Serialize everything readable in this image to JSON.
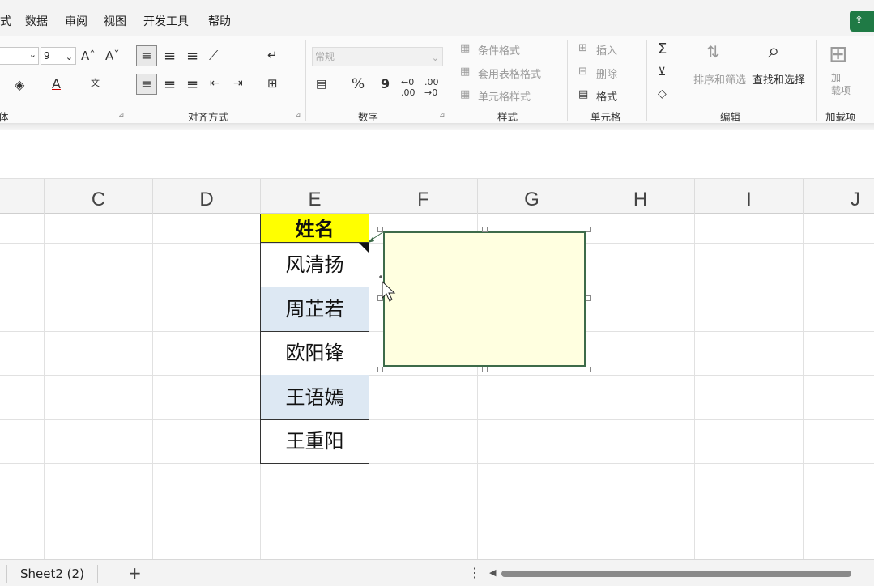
{
  "menu": {
    "items": [
      "式",
      "数据",
      "审阅",
      "视图",
      "开发工具",
      "帮助"
    ],
    "share_icon": "share-icon"
  },
  "ribbon": {
    "font": {
      "size_value": "9",
      "grow_label": "Aˆ",
      "shrink_label": "Aˇ",
      "group_label": "体"
    },
    "alignment": {
      "group_label": "对齐方式"
    },
    "number": {
      "format_value": "常规",
      "percent": "%",
      "comma": "9",
      "group_label": "数字"
    },
    "styles": {
      "conditional": "条件格式",
      "table": "套用表格格式",
      "cell_styles": "单元格样式",
      "group_label": "样式"
    },
    "cells": {
      "insert": "插入",
      "delete": "删除",
      "format": "格式",
      "group_label": "单元格"
    },
    "editing": {
      "sort_filter": "排序和筛选",
      "find_select": "查找和选择",
      "group_label": "编辑"
    },
    "addins": {
      "button": "加\n载项",
      "group_label": "加载项"
    }
  },
  "columns": [
    "C",
    "D",
    "E",
    "F",
    "G",
    "H",
    "I",
    "J"
  ],
  "table": {
    "header": "姓名",
    "rows": [
      "风清扬",
      "周芷若",
      "欧阳锋",
      "王语嫣",
      "王重阳"
    ]
  },
  "sheets": {
    "active": "Sheet2 (2)",
    "add_label": "+",
    "more_label": "⋮"
  },
  "colors": {
    "header_fill": "#ffff00",
    "alt_row_fill": "#dde8f3",
    "note_fill": "#ffffe0",
    "note_border": "#3d6b4a",
    "share_button": "#1f7a45"
  }
}
